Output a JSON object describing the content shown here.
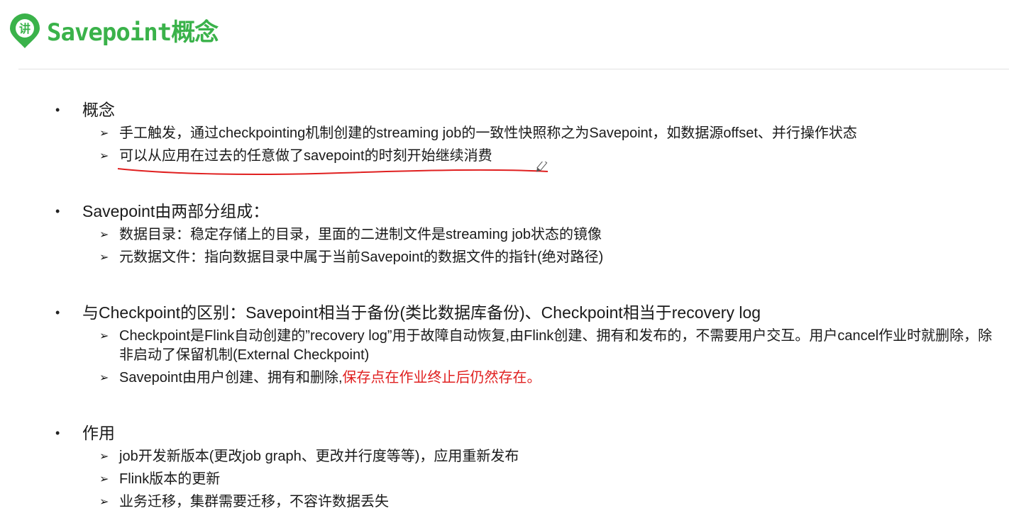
{
  "header": {
    "logo_text": "讲",
    "title": "Savepoint概念"
  },
  "sections": [
    {
      "heading": "概念",
      "items": [
        {
          "text": "手工触发，通过checkpointing机制创建的streaming job的一致性快照称之为Savepoint，如数据源offset、并行操作状态"
        },
        {
          "text": "可以从应用在过去的任意做了savepoint的时刻开始继续消费"
        }
      ]
    },
    {
      "heading": "Savepoint由两部分组成：",
      "items": [
        {
          "text": "数据目录：稳定存储上的目录，里面的二进制文件是streaming job状态的镜像"
        },
        {
          "text": "元数据文件：指向数据目录中属于当前Savepoint的数据文件的指针(绝对路径)"
        }
      ]
    },
    {
      "heading": "与Checkpoint的区别：Savepoint相当于备份(类比数据库备份)、Checkpoint相当于recovery log",
      "items": [
        {
          "text": "Checkpoint是Flink自动创建的”recovery log”用于故障自动恢复,由Flink创建、拥有和发布的，不需要用户交互。用户cancel作业时就删除，除非启动了保留机制(External Checkpoint)"
        },
        {
          "text": "Savepoint由用户创建、拥有和删除,",
          "highlight": "保存点在作业终止后仍然存在。"
        }
      ]
    },
    {
      "heading": "作用",
      "items": [
        {
          "text": "job开发新版本(更改job graph、更改并行度等等)，应用重新发布"
        },
        {
          "text": "Flink版本的更新"
        },
        {
          "text": "业务迁移，集群需要迁移，不容许数据丢失"
        }
      ]
    }
  ],
  "colors": {
    "title": "#3ab24a",
    "highlight": "#e02020",
    "annotation": "#e02020"
  }
}
